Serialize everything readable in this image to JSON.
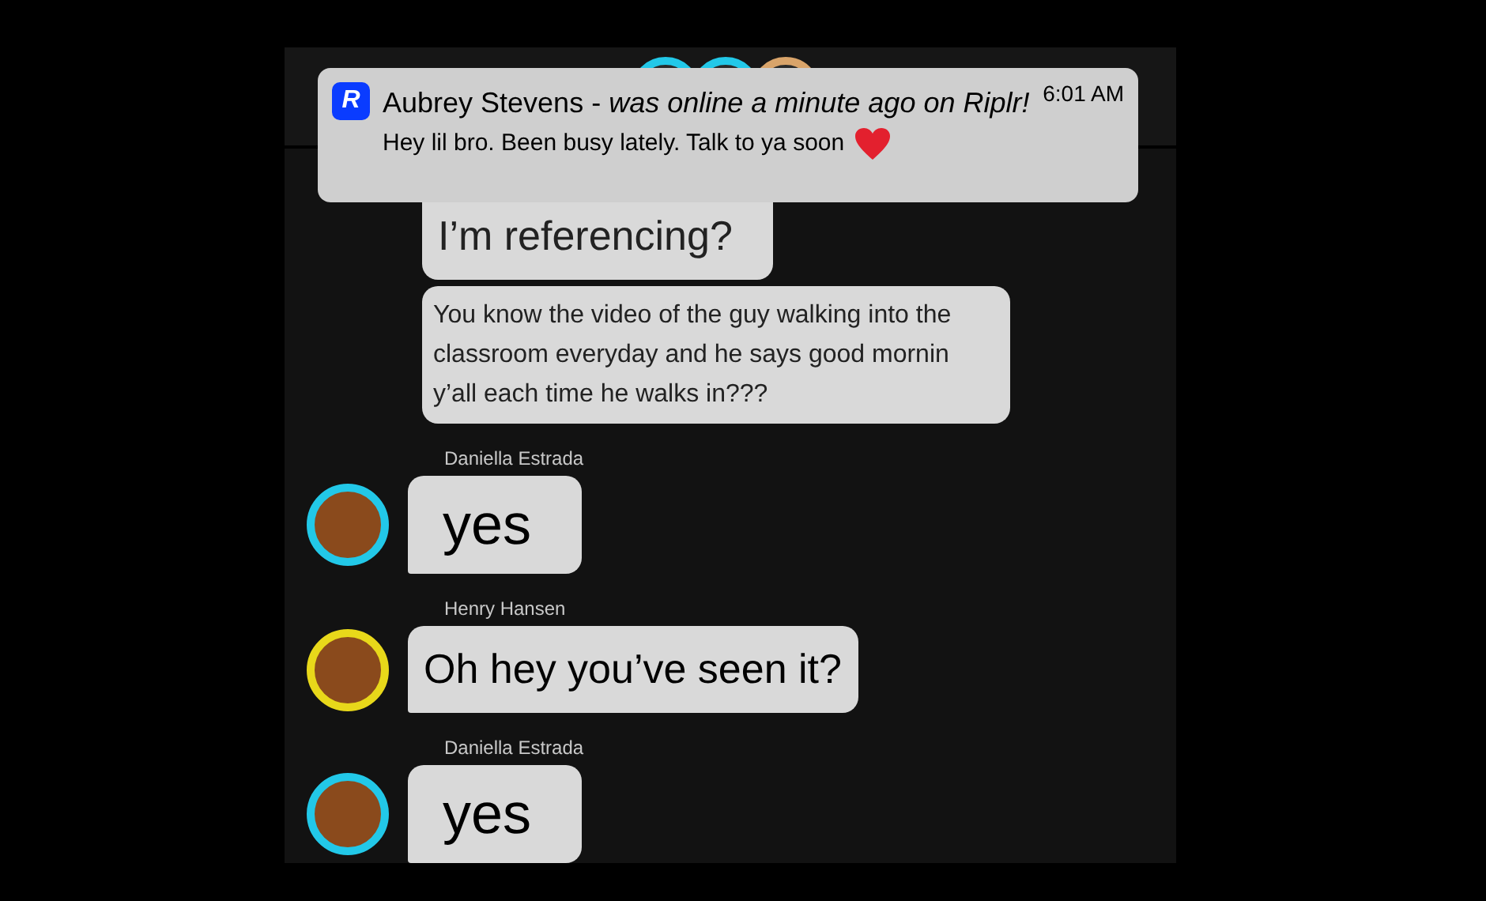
{
  "notification": {
    "app_icon_letter": "R",
    "title": "Aubrey Stevens - *was online a minute ago on Riplr!*",
    "time": "6:01 AM",
    "body": "Hey lil bro. Been busy lately. Talk to ya soon"
  },
  "header": {
    "avatars": [
      {
        "color": "#22c8e8"
      },
      {
        "color": "#22c8e8"
      },
      {
        "color": "#d9a46a"
      }
    ]
  },
  "messages": [
    {
      "text": "I’m referencing?"
    },
    {
      "text": "You know the video of the guy walking into the classroom everyday and he says good mornin y’all each time he walks in???"
    },
    {
      "sender": "Daniella Estrada",
      "color": "#22c8e8",
      "text": "yes"
    },
    {
      "sender": "Henry Hansen",
      "color": "#e8d81a",
      "text": "Oh hey you’ve seen it?"
    },
    {
      "sender": "Daniella Estrada",
      "color": "#22c8e8",
      "text": "yes"
    }
  ]
}
